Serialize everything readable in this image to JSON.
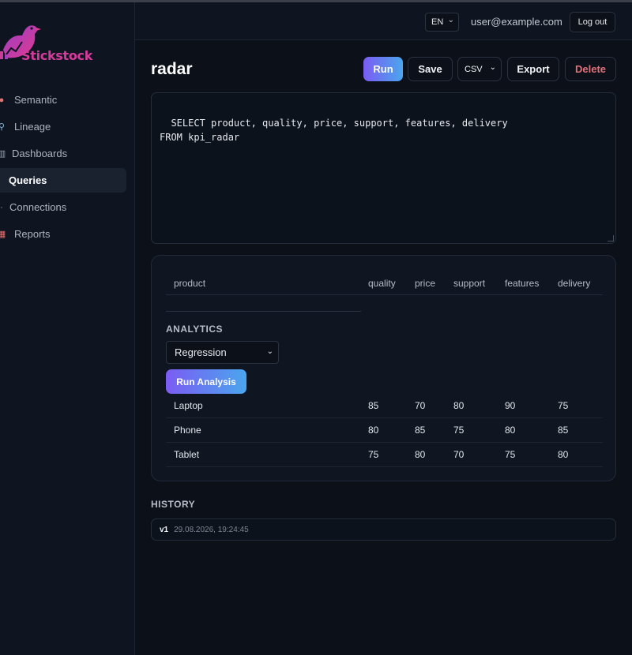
{
  "brand": {
    "name": "Stickstock",
    "color": "#d43b9b"
  },
  "sidebar": {
    "items": [
      {
        "label": "Semantic",
        "icon": "brain-icon",
        "glyph": "●",
        "color": "#e57373"
      },
      {
        "label": "Lineage",
        "icon": "link-icon",
        "glyph": "⚲",
        "color": "#7fb3d5"
      },
      {
        "label": "Dashboards",
        "icon": "dashboard-icon",
        "glyph": "▥",
        "color": "#9aa3b0"
      },
      {
        "label": "Queries",
        "icon": "query-icon",
        "glyph": "",
        "color": "#ffffff",
        "active": true
      },
      {
        "label": "Connections",
        "icon": "plug-icon",
        "glyph": "·",
        "color": "#9aa3b0"
      },
      {
        "label": "Reports",
        "icon": "calendar-icon",
        "glyph": "▦",
        "color": "#e57373"
      }
    ]
  },
  "header": {
    "language": "EN",
    "user_email": "user@example.com",
    "logout_label": "Log out"
  },
  "page": {
    "title": "radar"
  },
  "toolbar": {
    "run_label": "Run",
    "save_label": "Save",
    "format_value": "CSV",
    "export_label": "Export",
    "delete_label": "Delete"
  },
  "editor": {
    "sql": "SELECT product, quality, price, support, features, delivery\nFROM kpi_radar"
  },
  "results": {
    "columns": [
      "product",
      "quality",
      "price",
      "support",
      "features",
      "delivery"
    ],
    "rows": [
      [
        "Laptop",
        "85",
        "70",
        "80",
        "90",
        "75"
      ],
      [
        "Phone",
        "80",
        "85",
        "75",
        "80",
        "85"
      ],
      [
        "Tablet",
        "75",
        "80",
        "70",
        "75",
        "80"
      ]
    ]
  },
  "analytics": {
    "title": "ANALYTICS",
    "method": "Regression",
    "run_label": "Run Analysis"
  },
  "history": {
    "title": "HISTORY",
    "entries": [
      {
        "version": "v1",
        "timestamp": "29.08.2026, 19:24:45"
      }
    ]
  }
}
